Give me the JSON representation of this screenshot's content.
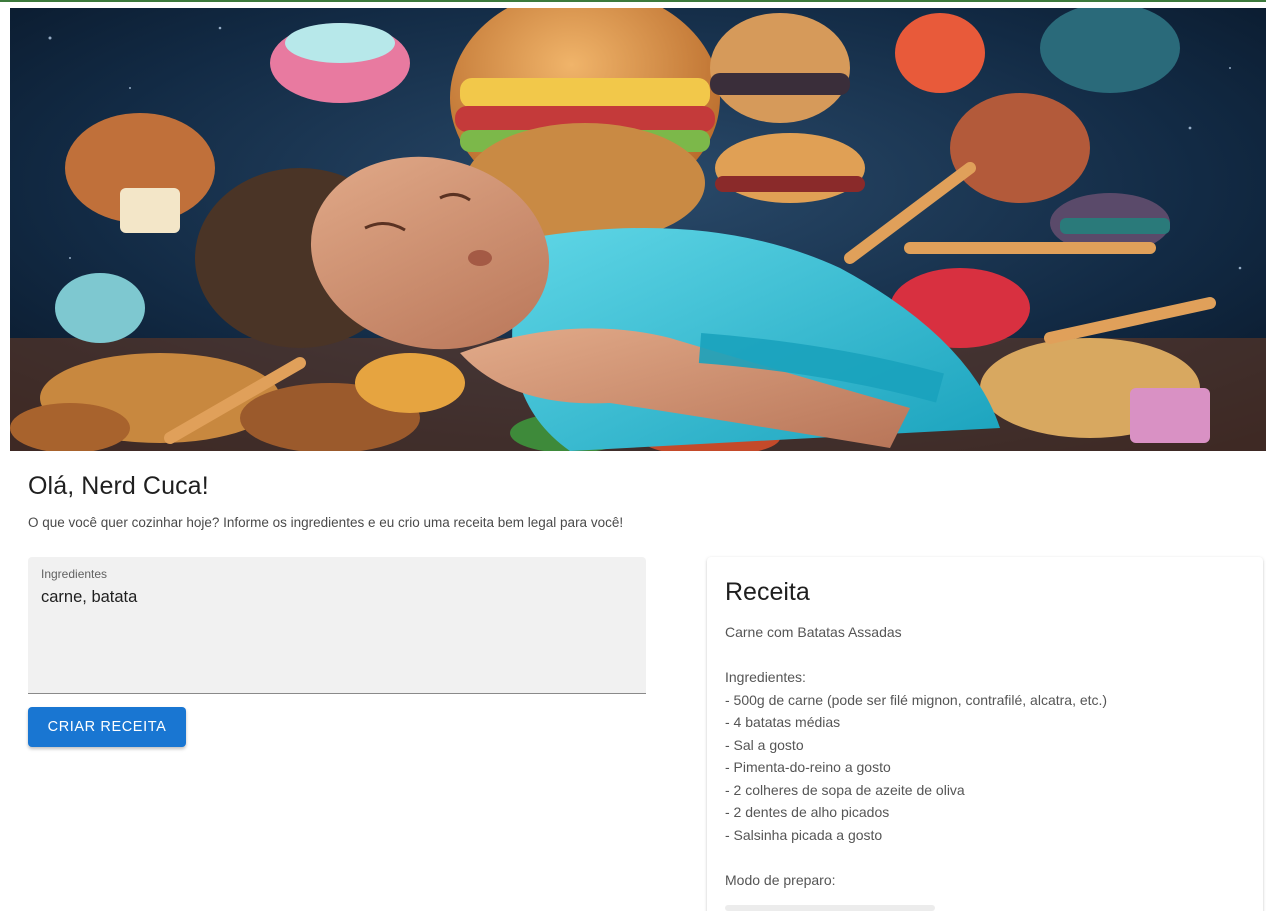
{
  "hero": {
    "image_name": "person-sleeping-surrounded-by-food-image"
  },
  "greeting": "Olá, Nerd Cuca!",
  "subtitle": "O que você quer cozinhar hoje? Informe os ingredientes e eu crio uma receita bem legal para você!",
  "ingredients_field": {
    "label": "Ingredientes",
    "value": "carne, batata"
  },
  "create_button_label": "CRIAR RECEITA",
  "recipe": {
    "title": "Receita",
    "name": "Carne com Batatas Assadas",
    "ingredients_heading": "Ingredientes:",
    "ingredients": [
      "- 500g de carne (pode ser filé mignon, contrafilé, alcatra, etc.)",
      "- 4 batatas médias",
      "- Sal a gosto",
      "- Pimenta-do-reino a gosto",
      "- 2 colheres de sopa de azeite de oliva",
      "- 2 dentes de alho picados",
      "- Salsinha picada a gosto"
    ],
    "method_heading": "Modo de preparo:"
  },
  "colors": {
    "accent": "#1976d2",
    "field_background": "#f1f1f1",
    "hero_background": "#0d1f33"
  }
}
